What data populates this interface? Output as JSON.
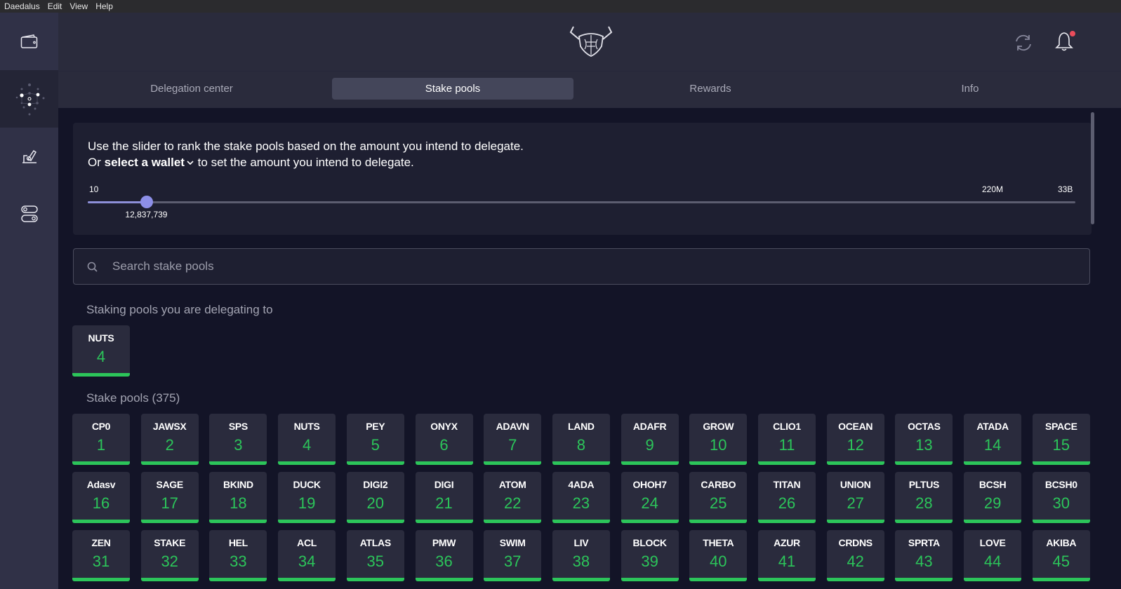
{
  "menubar": [
    "Daedalus",
    "Edit",
    "View",
    "Help"
  ],
  "sidebar": {
    "items": [
      {
        "name": "wallets",
        "icon": "wallet-icon",
        "active": false
      },
      {
        "name": "staking",
        "icon": "staking-icon",
        "active": true
      },
      {
        "name": "voting",
        "icon": "voting-icon",
        "active": false
      },
      {
        "name": "settings",
        "icon": "settings-toggle-icon",
        "active": false
      }
    ]
  },
  "header": {
    "logo": "daedalus-logo-icon",
    "sync_icon": "sync-icon",
    "notification_icon": "bell-icon",
    "notification_dot_color": "#ea4c5b"
  },
  "tabs": [
    {
      "label": "Delegation center",
      "active": false
    },
    {
      "label": "Stake pools",
      "active": true
    },
    {
      "label": "Rewards",
      "active": false
    },
    {
      "label": "Info",
      "active": false
    }
  ],
  "slider": {
    "line1": "Use the slider to rank the stake pools based on the amount you intend to delegate.",
    "line2_prefix": "Or ",
    "line2_link": "select a wallet",
    "line2_suffix": " to set the amount you intend to delegate.",
    "min_label": "10",
    "mid_label": "220M",
    "max_label": "33B",
    "current_value": "12,837,739",
    "position_fraction": 0.06
  },
  "search": {
    "placeholder": "Search stake pools",
    "value": ""
  },
  "delegating": {
    "title": "Staking pools you are delegating to",
    "pools": [
      {
        "ticker": "NUTS",
        "rank": "4"
      }
    ]
  },
  "stake_pools": {
    "title": "Stake pools (375)",
    "accent_color": "#2cc55a",
    "pools": [
      {
        "ticker": "CP0",
        "rank": "1"
      },
      {
        "ticker": "JAWSX",
        "rank": "2"
      },
      {
        "ticker": "SPS",
        "rank": "3"
      },
      {
        "ticker": "NUTS",
        "rank": "4"
      },
      {
        "ticker": "PEY",
        "rank": "5"
      },
      {
        "ticker": "ONYX",
        "rank": "6"
      },
      {
        "ticker": "ADAVN",
        "rank": "7"
      },
      {
        "ticker": "LAND",
        "rank": "8"
      },
      {
        "ticker": "ADAFR",
        "rank": "9"
      },
      {
        "ticker": "GROW",
        "rank": "10"
      },
      {
        "ticker": "CLIO1",
        "rank": "11"
      },
      {
        "ticker": "OCEAN",
        "rank": "12"
      },
      {
        "ticker": "OCTAS",
        "rank": "13"
      },
      {
        "ticker": "ATADA",
        "rank": "14"
      },
      {
        "ticker": "SPACE",
        "rank": "15"
      },
      {
        "ticker": "Adasv",
        "rank": "16"
      },
      {
        "ticker": "SAGE",
        "rank": "17"
      },
      {
        "ticker": "BKIND",
        "rank": "18"
      },
      {
        "ticker": "DUCK",
        "rank": "19"
      },
      {
        "ticker": "DIGI2",
        "rank": "20"
      },
      {
        "ticker": "DIGI",
        "rank": "21"
      },
      {
        "ticker": "ATOM",
        "rank": "22"
      },
      {
        "ticker": "4ADA",
        "rank": "23"
      },
      {
        "ticker": "OHOH7",
        "rank": "24"
      },
      {
        "ticker": "CARBO",
        "rank": "25"
      },
      {
        "ticker": "TITAN",
        "rank": "26"
      },
      {
        "ticker": "UNION",
        "rank": "27"
      },
      {
        "ticker": "PLTUS",
        "rank": "28"
      },
      {
        "ticker": "BCSH",
        "rank": "29"
      },
      {
        "ticker": "BCSH0",
        "rank": "30"
      },
      {
        "ticker": "ZEN",
        "rank": "31"
      },
      {
        "ticker": "STAKE",
        "rank": "32"
      },
      {
        "ticker": "HEL",
        "rank": "33"
      },
      {
        "ticker": "ACL",
        "rank": "34"
      },
      {
        "ticker": "ATLAS",
        "rank": "35"
      },
      {
        "ticker": "PMW",
        "rank": "36"
      },
      {
        "ticker": "SWIM",
        "rank": "37"
      },
      {
        "ticker": "LIV",
        "rank": "38"
      },
      {
        "ticker": "BLOCK",
        "rank": "39"
      },
      {
        "ticker": "THETA",
        "rank": "40"
      },
      {
        "ticker": "AZUR",
        "rank": "41"
      },
      {
        "ticker": "CRDNS",
        "rank": "42"
      },
      {
        "ticker": "SPRTA",
        "rank": "43"
      },
      {
        "ticker": "LOVE",
        "rank": "44"
      },
      {
        "ticker": "AKIBA",
        "rank": "45"
      }
    ]
  }
}
